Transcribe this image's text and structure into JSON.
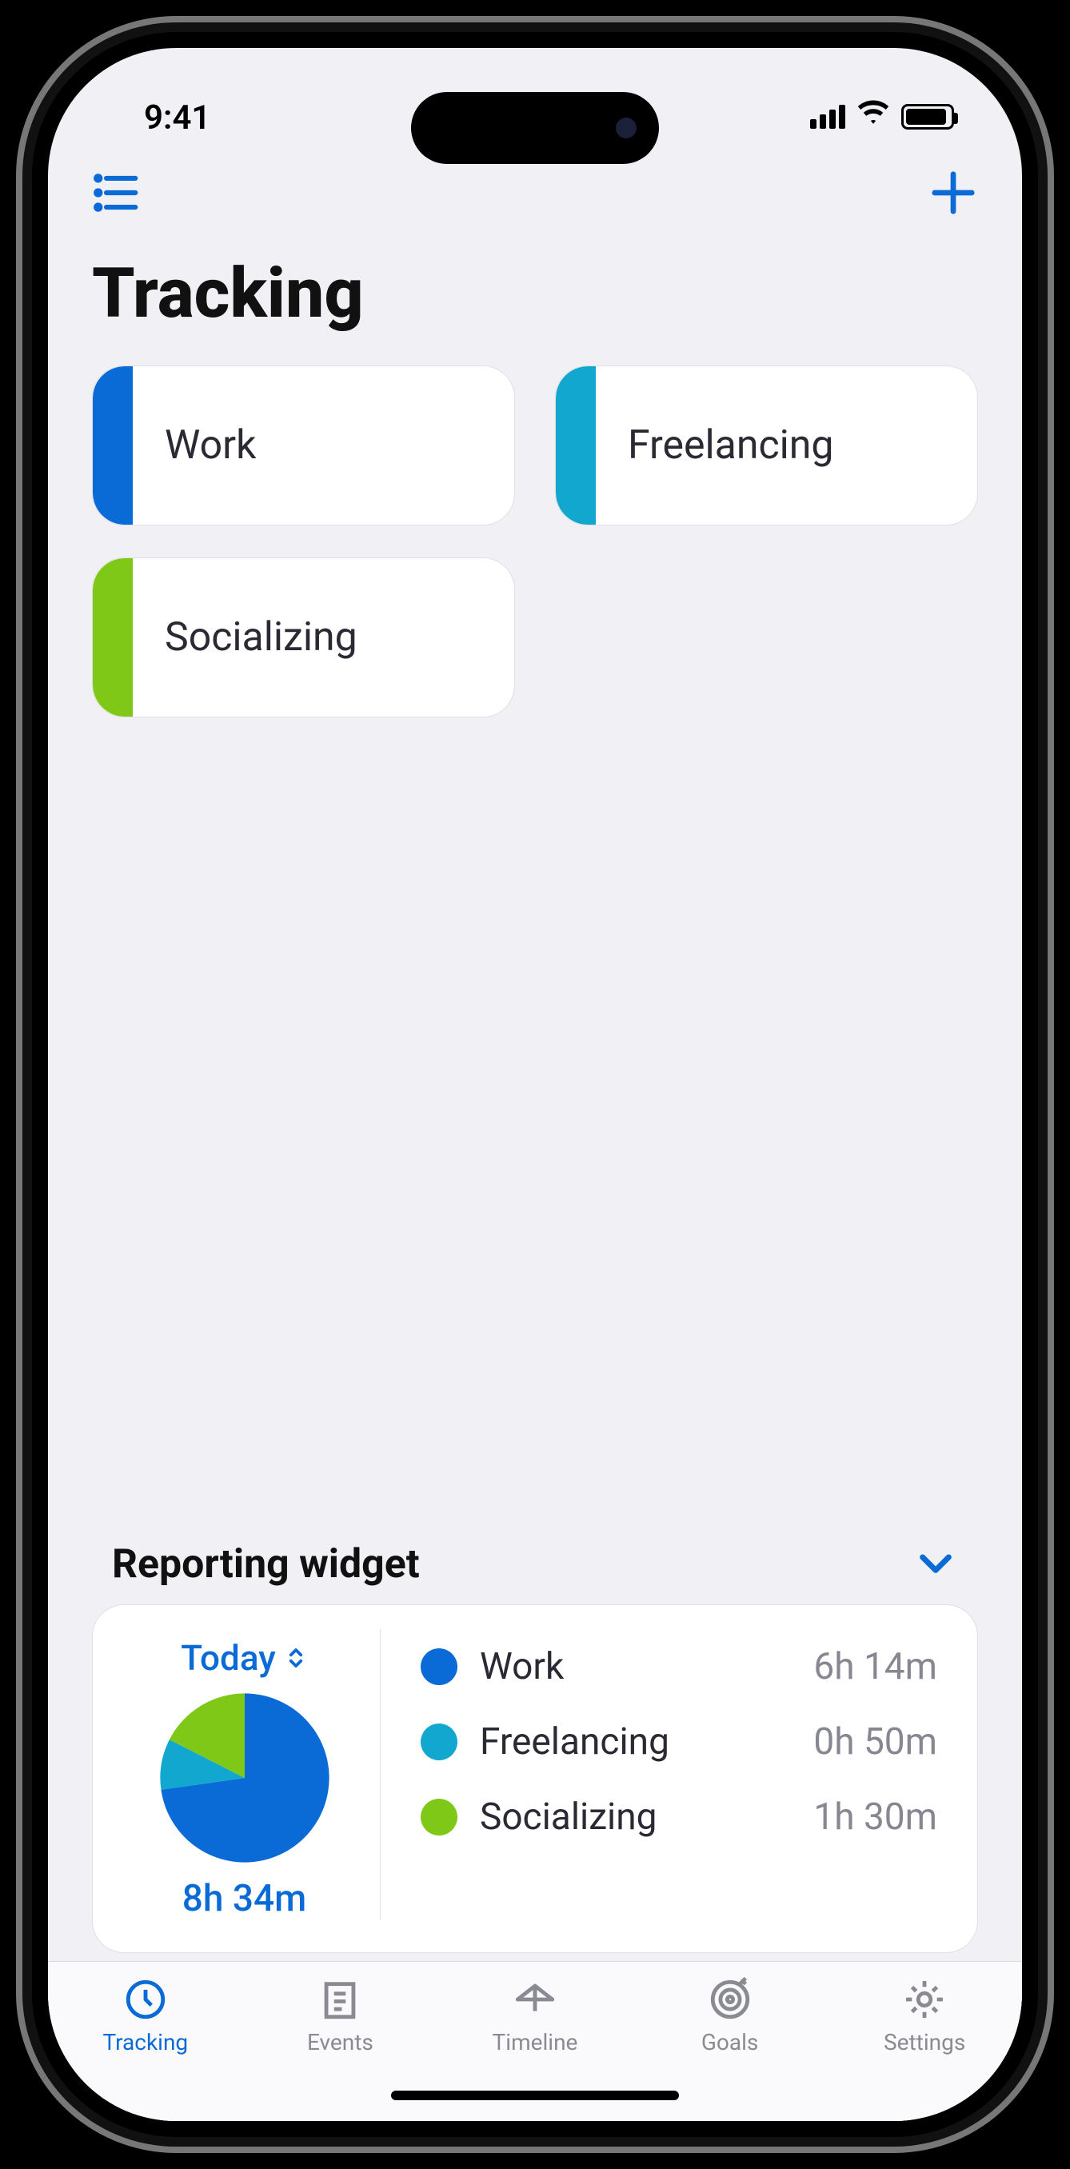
{
  "status": {
    "time": "9:41"
  },
  "nav": {
    "title": "Tracking"
  },
  "categories": [
    {
      "label": "Work",
      "color": "#0a6ad6"
    },
    {
      "label": "Freelancing",
      "color": "#12a7cf"
    },
    {
      "label": "Socializing",
      "color": "#7fc817"
    }
  ],
  "report": {
    "header": "Reporting widget",
    "period": "Today",
    "total": "8h 34m",
    "rows": [
      {
        "label": "Work",
        "time": "6h 14m",
        "color": "#0a6ad6"
      },
      {
        "label": "Freelancing",
        "time": "0h 50m",
        "color": "#12a7cf"
      },
      {
        "label": "Socializing",
        "time": "1h 30m",
        "color": "#7fc817"
      }
    ]
  },
  "chart_data": {
    "type": "pie",
    "title": "Today total 8h 34m",
    "series": [
      {
        "name": "Work",
        "minutes": 374,
        "color": "#0a6ad6"
      },
      {
        "name": "Freelancing",
        "minutes": 50,
        "color": "#12a7cf"
      },
      {
        "name": "Socializing",
        "minutes": 90,
        "color": "#7fc817"
      }
    ]
  },
  "tabs": [
    {
      "label": "Tracking",
      "active": true
    },
    {
      "label": "Events",
      "active": false
    },
    {
      "label": "Timeline",
      "active": false
    },
    {
      "label": "Goals",
      "active": false
    },
    {
      "label": "Settings",
      "active": false
    }
  ]
}
